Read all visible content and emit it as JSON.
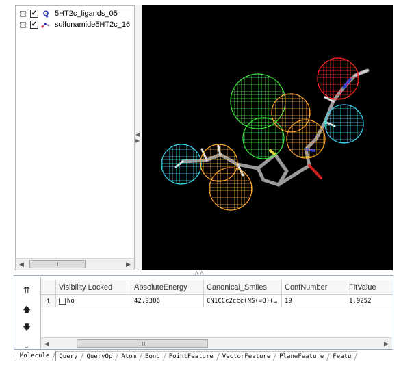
{
  "tree": {
    "items": [
      {
        "label": "5HT2c_ligands_05",
        "checked": "✓",
        "type_icon": "query-icon",
        "icon_text": "Q"
      },
      {
        "label": "sulfonamide5HT2c_16",
        "checked": "✓",
        "type_icon": "molecule-icon"
      }
    ]
  },
  "viewer": {
    "feature_colors": {
      "hydrophobic": "#3ad6ee",
      "hbond_acceptor": "#3ee83e",
      "hbond_donor": "#ffa630",
      "positive_ionizable": "#ff2626"
    },
    "background": "#000000"
  },
  "side_buttons": {
    "top_icon": "move-to-top-icon",
    "up_icon": "move-up-icon",
    "down_icon": "move-down-icon",
    "more_icon": "more-chevron-icon"
  },
  "grid": {
    "columns": [
      "",
      "Visibility Locked",
      "AbsoluteEnergy",
      "Canonical_Smiles",
      "ConfNumber",
      "FitValue"
    ],
    "rows": [
      {
        "num": "1",
        "visibility_locked": "No",
        "absolute_energy": "42.9306",
        "canonical_smiles": "CN1CCc2ccc(NS(=O)(…",
        "conf_number": "19",
        "fit_value": "1.9252"
      }
    ]
  },
  "tabs": [
    "Molecule",
    "Query",
    "QueryOp",
    "Atom",
    "Bond",
    "PointFeature",
    "VectorFeature",
    "PlaneFeature",
    "Featu"
  ]
}
